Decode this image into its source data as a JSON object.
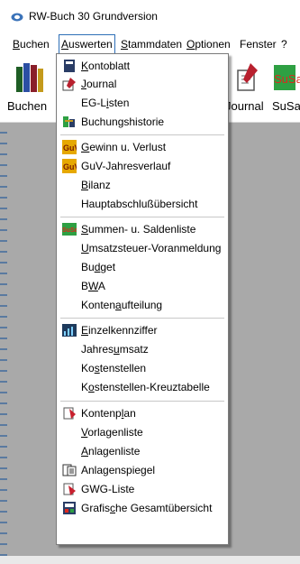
{
  "window": {
    "title": "RW-Buch 30 Grundversion"
  },
  "menubar": {
    "items": [
      "Buchen",
      "Auswerten",
      "Stammdaten",
      "Optionen",
      "Fenster",
      "?"
    ]
  },
  "toolbar": {
    "buttons": [
      {
        "label": "Buchen",
        "icon": "books-icon"
      },
      {
        "label": "Journal",
        "icon": "journal-icon"
      },
      {
        "label": "SuSa",
        "icon": "susa-icon"
      }
    ]
  },
  "auswerten_menu": {
    "items": [
      {
        "label": "Kontoblatt",
        "icon": "book-icon",
        "group": 1
      },
      {
        "label": "Journal",
        "icon": "journal-icon",
        "group": 1
      },
      {
        "label": "EG-Listen",
        "icon": "",
        "group": 1
      },
      {
        "label": "Buchungshistorie",
        "icon": "history-icon",
        "group": 1
      },
      {
        "label": "Gewinn u. Verlust",
        "icon": "guv-icon",
        "group": 2
      },
      {
        "label": "GuV-Jahresverlauf",
        "icon": "guv-icon",
        "group": 2
      },
      {
        "label": "Bilanz",
        "icon": "",
        "group": 2
      },
      {
        "label": "Hauptabschlußübersicht",
        "icon": "",
        "group": 2
      },
      {
        "label": "Summen- u. Saldenliste",
        "icon": "susa-icon",
        "group": 3
      },
      {
        "label": "Umsatzsteuer-Voranmeldung",
        "icon": "",
        "group": 3
      },
      {
        "label": "Budget",
        "icon": "",
        "group": 3
      },
      {
        "label": "BWA",
        "icon": "",
        "group": 3
      },
      {
        "label": "Kontenaufteilung",
        "icon": "",
        "group": 3
      },
      {
        "label": "Einzelkennziffer",
        "icon": "chart-icon",
        "group": 4
      },
      {
        "label": "Jahresumsatz",
        "icon": "",
        "group": 4
      },
      {
        "label": "Kostenstellen",
        "icon": "",
        "group": 4
      },
      {
        "label": "Kostenstellen-Kreuztabelle",
        "icon": "",
        "group": 4
      },
      {
        "label": "Kontenplan",
        "icon": "kontenplan-icon",
        "group": 5
      },
      {
        "label": "Vorlagenliste",
        "icon": "",
        "group": 5
      },
      {
        "label": "Anlagenliste",
        "icon": "",
        "group": 5
      },
      {
        "label": "Anlagenspiegel",
        "icon": "anlagenspiegel-icon",
        "group": 5
      },
      {
        "label": "GWG-Liste",
        "icon": "gwg-icon",
        "group": 5
      },
      {
        "label": "Grafische Gesamtübersicht",
        "icon": "overview-icon",
        "group": 5
      }
    ]
  },
  "colors": {
    "menu_border": "#7a7a7a",
    "active_menu_border": "#2e6fb7",
    "workspace": "#a9a9a9",
    "susa_red": "#e0281e",
    "susa_green": "#2ea043"
  }
}
